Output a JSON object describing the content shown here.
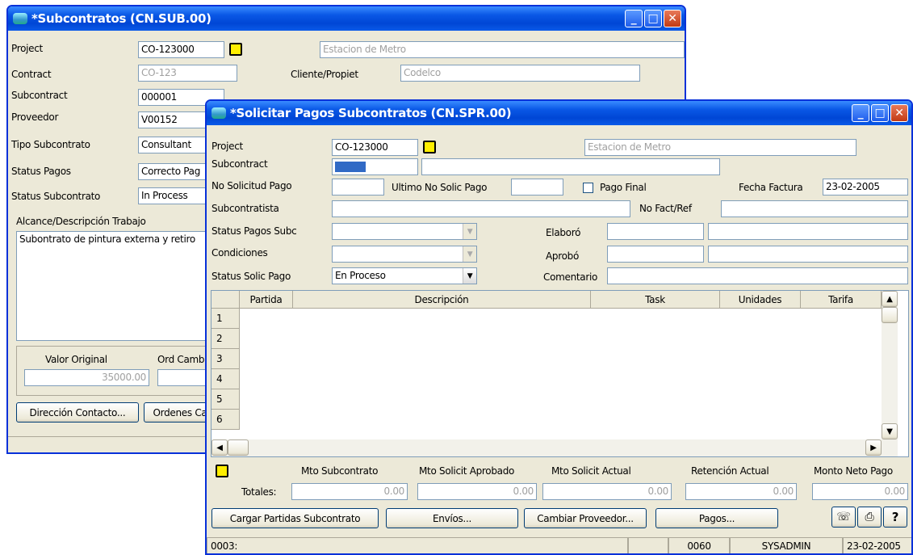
{
  "win1": {
    "title": "*Subcontratos (CN.SUB.00)",
    "project_label": "Project",
    "project_value": "CO-123000",
    "project_desc": "Estacion de Metro",
    "contract_label": "Contract",
    "contract_value": "CO-123",
    "client_label": "Cliente/Propiet",
    "client_value": "Codelco",
    "subcontract_label": "Subcontract",
    "subcontract_value": "000001",
    "proveedor_label": "Proveedor",
    "proveedor_value": "V00152",
    "tipo_label": "Tipo Subcontrato",
    "tipo_value": "Consultant",
    "status_pagos_label": "Status Pagos",
    "status_pagos_value": "Correcto Pag",
    "status_sub_label": "Status Subcontrato",
    "status_sub_value": "In Process",
    "alcance_label": "Alcance/Descripción Trabajo",
    "alcance_value": "Subontrato de pintura externa y retiro",
    "valor_label": "Valor Original",
    "valor_value": "35000.00",
    "ord_label": "Ord Cambi",
    "btn_direccion": "Dirección Contacto...",
    "btn_ordenes": "Ordenes Ca"
  },
  "win2": {
    "title": "*Solicitar Pagos Subcontratos (CN.SPR.00)",
    "project_label": "Project",
    "project_value": "CO-123000",
    "project_desc": "Estacion de Metro",
    "subcontract_label": "Subcontract",
    "no_solicitud_label": "No Solicitud Pago",
    "ultimo_label": "Ultimo No Solic Pago",
    "pago_final_label": "Pago Final",
    "fecha_factura_label": "Fecha Factura",
    "fecha_factura_value": "23-02-2005",
    "subcontratista_label": "Subcontratista",
    "no_fact_label": "No Fact/Ref",
    "status_pagos_label": "Status Pagos Subc",
    "condiciones_label": "Condiciones",
    "status_solic_label": "Status Solic Pago",
    "status_solic_value": "En Proceso",
    "elaboro_label": "Elaboró",
    "aprobo_label": "Aprobó",
    "comentario_label": "Comentario",
    "grid_headers": [
      "Partida",
      "Descripción",
      "Task",
      "Unidades",
      "Tarifa"
    ],
    "row_numbers": [
      "1",
      "2",
      "3",
      "4",
      "5",
      "6"
    ],
    "totals_headers": [
      "Mto Subcontrato",
      "Mto Solicit Aprobado",
      "Mto Solicit Actual",
      "Retención Actual",
      "Monto Neto Pago"
    ],
    "totales_label": "Totales:",
    "totals_values": [
      "0.00",
      "0.00",
      "0.00",
      "0.00",
      "0.00"
    ],
    "btn_cargar": "Cargar Partidas Subcontrato",
    "btn_envios": "Envíos...",
    "btn_cambiar": "Cambiar Proveedor...",
    "btn_pagos": "Pagos...",
    "status_bar": [
      "0003:",
      "",
      "0060",
      "SYSADMIN",
      "23-02-2005"
    ]
  }
}
